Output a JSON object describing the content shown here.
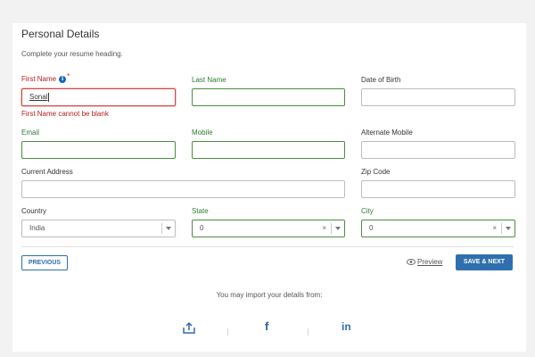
{
  "section": {
    "title": "Personal Details",
    "subtitle": "Complete your resume heading."
  },
  "fields": {
    "first_name": {
      "label": "First Name",
      "required_mark": "*",
      "value": "Sonal",
      "error": "First Name cannot be blank"
    },
    "last_name": {
      "label": "Last Name",
      "value": ""
    },
    "dob": {
      "label": "Date of Birth",
      "value": ""
    },
    "email": {
      "label": "Email",
      "value": ""
    },
    "mobile": {
      "label": "Mobile",
      "value": ""
    },
    "alt_mobile": {
      "label": "Alternate Mobile",
      "value": ""
    },
    "address": {
      "label": "Current Address",
      "value": ""
    },
    "zip": {
      "label": "Zip Code",
      "value": ""
    },
    "country": {
      "label": "Country",
      "value": "India"
    },
    "state": {
      "label": "State",
      "value": "0",
      "clear": "×"
    },
    "city": {
      "label": "City",
      "value": "0",
      "clear": "×"
    }
  },
  "actions": {
    "previous": "PREVIOUS",
    "preview": "Preview",
    "save_next": "SAVE & NEXT"
  },
  "import": {
    "message": "You may import your details from:",
    "facebook_glyph": "f",
    "linkedin_glyph": "in",
    "icons": [
      "upload-icon",
      "facebook-icon",
      "linkedin-icon"
    ]
  },
  "colors": {
    "accent": "#2f6fad",
    "valid_border": "#4a8f3e",
    "error": "#b71c1c"
  }
}
